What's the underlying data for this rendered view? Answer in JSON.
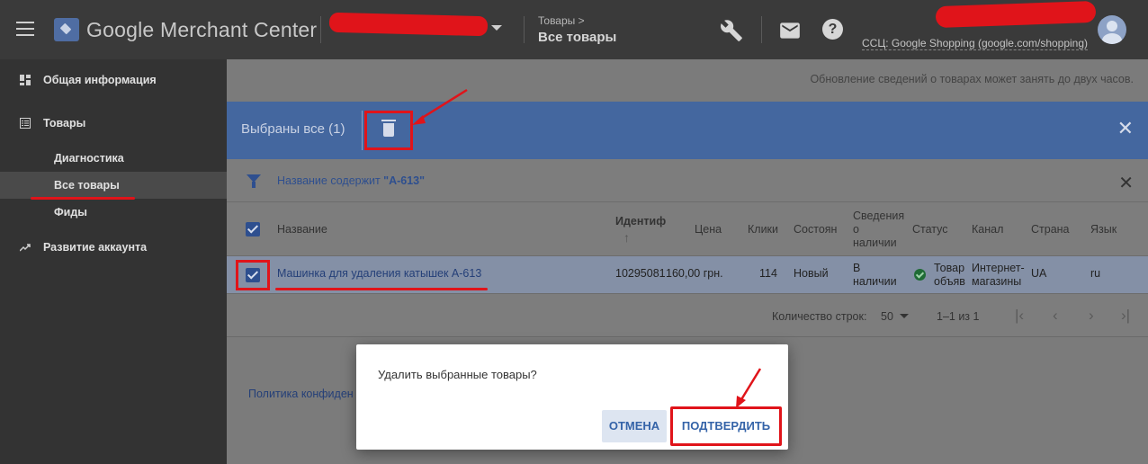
{
  "header": {
    "product_name": "Google Merchant Center",
    "breadcrumb_parent": "Товары",
    "breadcrumb_current": "Все товары",
    "cssl_link": "ССЦ: Google Shopping (google.com/shopping)",
    "icons": [
      "menu-icon",
      "wrench-icon",
      "mail-icon",
      "help-icon",
      "avatar"
    ]
  },
  "sidebar": {
    "items": [
      {
        "label": "Общая информация",
        "icon": "dashboard-icon"
      },
      {
        "label": "Товары",
        "icon": "list-icon"
      },
      {
        "label": "Диагностика"
      },
      {
        "label": "Все товары",
        "active": true
      },
      {
        "label": "Фиды"
      },
      {
        "label": "Развитие аккаунта",
        "icon": "trending-up-icon"
      }
    ]
  },
  "main": {
    "notice": "Обновление сведений о товарах может занять до двух часов.",
    "selection_bar": {
      "label": "Выбраны все (1)",
      "color": "#44679f"
    },
    "filter": {
      "prefix": "Название содержит ",
      "value": "\"A-613\""
    },
    "table": {
      "columns": [
        "Название",
        "Идентиф",
        "Цена",
        "Клики",
        "Состоян",
        "Сведения о наличии",
        "Статус",
        "Канал",
        "Страна",
        "Язык"
      ],
      "rows": [
        {
          "name": "Машинка для удаления катышек A-613",
          "id": "10295081",
          "price": "160,00 грн.",
          "clicks": "114",
          "condition": "Новый",
          "availability": "В наличии",
          "status": "Товар объяв",
          "channel": "Интернет-магазины",
          "country": "UA",
          "language": "ru"
        }
      ]
    },
    "pagination": {
      "rows_label": "Количество строк:",
      "rows_value": "50",
      "range": "1–1 из 1"
    },
    "policy_link": "Политика конфиден"
  },
  "dialog": {
    "message": "Удалить выбранные товары?",
    "cancel": "ОТМЕНА",
    "confirm": "ПОДТВЕРДИТЬ"
  },
  "colors": {
    "accent": "#3463a8",
    "annotation_red": "#e0141a",
    "topbar": "#3a3a3a",
    "sidebar": "#333333"
  }
}
